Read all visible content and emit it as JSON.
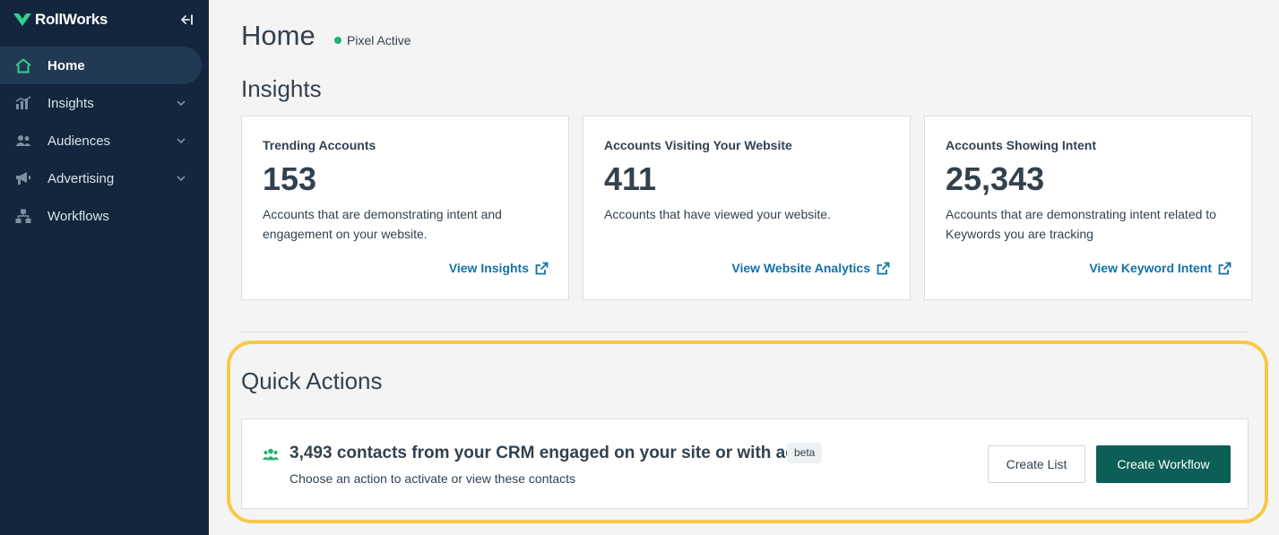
{
  "sidebar": {
    "brand": "RollWorks",
    "items": [
      {
        "label": "Home",
        "icon": "home-icon",
        "active": true,
        "expandable": false
      },
      {
        "label": "Insights",
        "icon": "chart-icon",
        "active": false,
        "expandable": true
      },
      {
        "label": "Audiences",
        "icon": "people-icon",
        "active": false,
        "expandable": true
      },
      {
        "label": "Advertising",
        "icon": "megaphone-icon",
        "active": false,
        "expandable": true
      },
      {
        "label": "Workflows",
        "icon": "workflow-icon",
        "active": false,
        "expandable": false
      }
    ]
  },
  "header": {
    "title": "Home",
    "pixel_status": "Pixel Active",
    "pixel_status_color": "#1fb26b"
  },
  "insights": {
    "title": "Insights",
    "cards": [
      {
        "title": "Trending Accounts",
        "value": "153",
        "description": "Accounts that are demonstrating intent and engagement on your website.",
        "link": "View Insights"
      },
      {
        "title": "Accounts Visiting Your Website",
        "value": "411",
        "description": "Accounts that have viewed your website.",
        "link": "View Website Analytics"
      },
      {
        "title": "Accounts Showing Intent",
        "value": "25,343",
        "description": "Accounts that are demonstrating intent related to Keywords you are tracking",
        "link": "View Keyword Intent"
      }
    ]
  },
  "quick_actions": {
    "title": "Quick Actions",
    "headline": "3,493 contacts from your CRM engaged on your site or with ads",
    "badge": "beta",
    "subtext": "Choose an action to activate or view these contacts",
    "create_list_label": "Create List",
    "create_workflow_label": "Create Workflow",
    "highlight_color": "#f7c948"
  },
  "colors": {
    "sidebar_bg": "#13263d",
    "accent_green": "#0c5f56",
    "link_blue": "#1271a8"
  }
}
